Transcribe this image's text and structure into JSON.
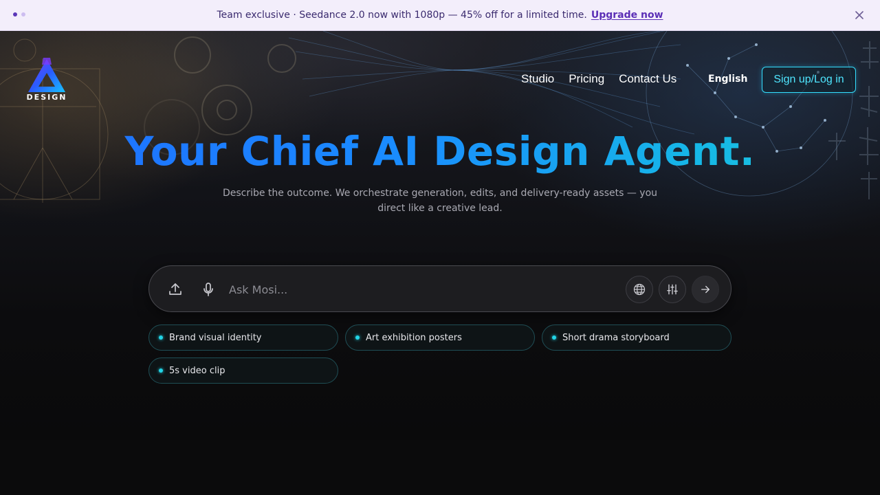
{
  "announcement": {
    "message": "Team exclusive · Seedance 2.0 now with 1080p — 45% off for a limited time.",
    "cta": "Upgrade now",
    "slide_count": 2,
    "active_slide": 1
  },
  "brand": {
    "logo_text": "DESIGN",
    "colors": {
      "accent_cyan": "#34e0ff",
      "headline_start": "#1f6bff",
      "headline_end": "#1fc9d8",
      "announce_bg": "#f3eefb"
    }
  },
  "nav": {
    "items": [
      "Studio",
      "Pricing",
      "Contact Us"
    ],
    "language": "English",
    "signin": "Sign up/Log in"
  },
  "hero": {
    "title": "Your Chief AI Design Agent.",
    "subtitle": "Describe the outcome. We orchestrate generation, edits, and delivery-ready assets — you direct like a creative lead."
  },
  "prompt": {
    "placeholder": "Ask Mosi...",
    "value": "",
    "icons": [
      "upload-icon",
      "microphone-icon",
      "globe-icon",
      "sliders-icon",
      "arrow-right-icon"
    ]
  },
  "suggestions": [
    "Brand visual identity",
    "Art exhibition posters",
    "Short drama storyboard",
    "5s video clip"
  ]
}
